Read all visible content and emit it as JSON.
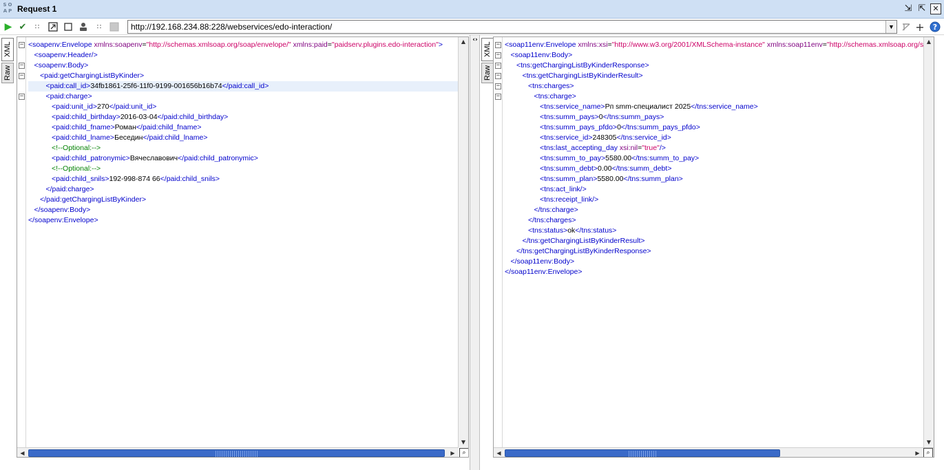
{
  "window": {
    "title": "Request 1",
    "logo_text": "SOAP",
    "icons": [
      "restore-icon",
      "maximize-icon",
      "close-icon"
    ]
  },
  "toolbar": {
    "url": "http://192.168.234.88:228/webservices/edo-interaction/",
    "buttons": [
      "run-icon",
      "validate-icon",
      "spam-icon",
      "export-icon",
      "stop-icon",
      "user-icon",
      "spam2-icon",
      "disabled-icon"
    ],
    "right_buttons": [
      "wsdl-icon",
      "add-icon",
      "help-icon"
    ]
  },
  "request": {
    "tabs": {
      "xml": "XML",
      "raw": "Raw"
    },
    "lines": [
      {
        "indent": 0,
        "fold": true,
        "parts": [
          [
            "tg",
            "<soapenv:Envelope "
          ],
          [
            "an",
            "xmlns:soapenv"
          ],
          [
            "tx",
            "="
          ],
          [
            "av",
            "\"http://schemas.xmlsoap.org/soap/envelope/\""
          ],
          [
            "tx",
            " "
          ],
          [
            "an",
            "xmlns:paid"
          ],
          [
            "tx",
            "="
          ],
          [
            "av",
            "\"paidserv.plugins.edo-interaction\""
          ],
          [
            "tg",
            ">"
          ]
        ]
      },
      {
        "indent": 1,
        "parts": [
          [
            "tg",
            "<soapenv:Header/>"
          ]
        ]
      },
      {
        "indent": 1,
        "fold": true,
        "parts": [
          [
            "tg",
            "<soapenv:Body>"
          ]
        ]
      },
      {
        "indent": 2,
        "fold": true,
        "parts": [
          [
            "tg",
            "<paid:getChargingListByKinder>"
          ]
        ]
      },
      {
        "indent": 3,
        "hl": true,
        "parts": [
          [
            "tg",
            "<paid:call_id>"
          ],
          [
            "tx",
            "34fb1861-25f6-11f0-9199-001656b16b74"
          ],
          [
            "tg",
            "</paid:call_id>"
          ]
        ]
      },
      {
        "indent": 3,
        "fold": true,
        "parts": [
          [
            "tg",
            "<paid:charge>"
          ]
        ]
      },
      {
        "indent": 4,
        "parts": [
          [
            "tg",
            "<paid:unit_id>"
          ],
          [
            "tx",
            "270"
          ],
          [
            "tg",
            "</paid:unit_id>"
          ]
        ]
      },
      {
        "indent": 4,
        "parts": [
          [
            "tg",
            "<paid:child_birthday>"
          ],
          [
            "tx",
            "2016-03-04"
          ],
          [
            "tg",
            "</paid:child_birthday>"
          ]
        ]
      },
      {
        "indent": 4,
        "parts": [
          [
            "tg",
            "<paid:child_fname>"
          ],
          [
            "tx",
            "Роман"
          ],
          [
            "tg",
            "</paid:child_fname>"
          ]
        ]
      },
      {
        "indent": 4,
        "parts": [
          [
            "tg",
            "<paid:child_lname>"
          ],
          [
            "tx",
            "Беседин"
          ],
          [
            "tg",
            "</paid:child_lname>"
          ]
        ]
      },
      {
        "indent": 4,
        "parts": [
          [
            "cm",
            "<!--Optional:-->"
          ]
        ]
      },
      {
        "indent": 4,
        "parts": [
          [
            "tg",
            "<paid:child_patronymic>"
          ],
          [
            "tx",
            "Вячеславович"
          ],
          [
            "tg",
            "</paid:child_patronymic>"
          ]
        ]
      },
      {
        "indent": 4,
        "parts": [
          [
            "cm",
            "<!--Optional:-->"
          ]
        ]
      },
      {
        "indent": 4,
        "parts": [
          [
            "tg",
            "<paid:child_snils>"
          ],
          [
            "tx",
            "192-998-874 66"
          ],
          [
            "tg",
            "</paid:child_snils>"
          ]
        ]
      },
      {
        "indent": 3,
        "parts": [
          [
            "tg",
            "</paid:charge>"
          ]
        ]
      },
      {
        "indent": 2,
        "parts": [
          [
            "tg",
            "</paid:getChargingListByKinder>"
          ]
        ]
      },
      {
        "indent": 1,
        "parts": [
          [
            "tg",
            "</soapenv:Body>"
          ]
        ]
      },
      {
        "indent": 0,
        "parts": [
          [
            "tg",
            "</soapenv:Envelope>"
          ]
        ]
      }
    ]
  },
  "response": {
    "tabs": {
      "xml": "XML",
      "raw": "Raw"
    },
    "lines": [
      {
        "indent": 0,
        "fold": true,
        "parts": [
          [
            "tg",
            "<soap11env:Envelope "
          ],
          [
            "an",
            "xmlns:xsi"
          ],
          [
            "tx",
            "="
          ],
          [
            "av",
            "\"http://www.w3.org/2001/XMLSchema-instance\""
          ],
          [
            "tx",
            " "
          ],
          [
            "an",
            "xmlns:soap11env"
          ],
          [
            "tx",
            "="
          ],
          [
            "av",
            "\"http://schemas.xmlsoap.org/soap/envelope/\""
          ]
        ]
      },
      {
        "indent": 1,
        "fold": true,
        "parts": [
          [
            "tg",
            "<soap11env:Body>"
          ]
        ]
      },
      {
        "indent": 2,
        "fold": true,
        "parts": [
          [
            "tg",
            "<tns:getChargingListByKinderResponse>"
          ]
        ]
      },
      {
        "indent": 3,
        "fold": true,
        "parts": [
          [
            "tg",
            "<tns:getChargingListByKinderResult>"
          ]
        ]
      },
      {
        "indent": 4,
        "fold": true,
        "parts": [
          [
            "tg",
            "<tns:charges>"
          ]
        ]
      },
      {
        "indent": 5,
        "fold": true,
        "parts": [
          [
            "tg",
            "<tns:charge>"
          ]
        ]
      },
      {
        "indent": 6,
        "parts": [
          [
            "tg",
            "<tns:service_name>"
          ],
          [
            "tx",
            "Рп smm-специалист 2025"
          ],
          [
            "tg",
            "</tns:service_name>"
          ]
        ]
      },
      {
        "indent": 6,
        "parts": [
          [
            "tg",
            "<tns:summ_pays>"
          ],
          [
            "tx",
            "0"
          ],
          [
            "tg",
            "</tns:summ_pays>"
          ]
        ]
      },
      {
        "indent": 6,
        "parts": [
          [
            "tg",
            "<tns:summ_pays_pfdo>"
          ],
          [
            "tx",
            "0"
          ],
          [
            "tg",
            "</tns:summ_pays_pfdo>"
          ]
        ]
      },
      {
        "indent": 6,
        "parts": [
          [
            "tg",
            "<tns:service_id>"
          ],
          [
            "tx",
            "248305"
          ],
          [
            "tg",
            "</tns:service_id>"
          ]
        ]
      },
      {
        "indent": 6,
        "parts": [
          [
            "tg",
            "<tns:last_accepting_day "
          ],
          [
            "an",
            "xsi:nil"
          ],
          [
            "tx",
            "="
          ],
          [
            "av",
            "\"true\""
          ],
          [
            "tg",
            "/>"
          ]
        ]
      },
      {
        "indent": 6,
        "parts": [
          [
            "tg",
            "<tns:summ_to_pay>"
          ],
          [
            "tx",
            "5580.00"
          ],
          [
            "tg",
            "</tns:summ_to_pay>"
          ]
        ]
      },
      {
        "indent": 6,
        "parts": [
          [
            "tg",
            "<tns:summ_debt>"
          ],
          [
            "tx",
            "0.00"
          ],
          [
            "tg",
            "</tns:summ_debt>"
          ]
        ]
      },
      {
        "indent": 6,
        "parts": [
          [
            "tg",
            "<tns:summ_plan>"
          ],
          [
            "tx",
            "5580.00"
          ],
          [
            "tg",
            "</tns:summ_plan>"
          ]
        ]
      },
      {
        "indent": 6,
        "parts": [
          [
            "tg",
            "<tns:act_link/>"
          ]
        ]
      },
      {
        "indent": 6,
        "parts": [
          [
            "tg",
            "<tns:receipt_link/>"
          ]
        ]
      },
      {
        "indent": 5,
        "parts": [
          [
            "tg",
            "</tns:charge>"
          ]
        ]
      },
      {
        "indent": 4,
        "parts": [
          [
            "tg",
            "</tns:charges>"
          ]
        ]
      },
      {
        "indent": 4,
        "parts": [
          [
            "tg",
            "<tns:status>"
          ],
          [
            "tx",
            "ok"
          ],
          [
            "tg",
            "</tns:status>"
          ]
        ]
      },
      {
        "indent": 3,
        "parts": [
          [
            "tg",
            "</tns:getChargingListByKinderResult>"
          ]
        ]
      },
      {
        "indent": 2,
        "parts": [
          [
            "tg",
            "</tns:getChargingListByKinderResponse>"
          ]
        ]
      },
      {
        "indent": 1,
        "parts": [
          [
            "tg",
            "</soap11env:Body>"
          ]
        ]
      },
      {
        "indent": 0,
        "parts": [
          [
            "tg",
            "</soap11env:Envelope>"
          ]
        ]
      }
    ]
  },
  "colors": {
    "tag": "#0000cc",
    "attr_name": "#7f007f",
    "attr_value": "#cc0066",
    "comment": "#008000",
    "titlebar": "#cfe0f4",
    "scroll_thumb": "#3a6ac8"
  }
}
